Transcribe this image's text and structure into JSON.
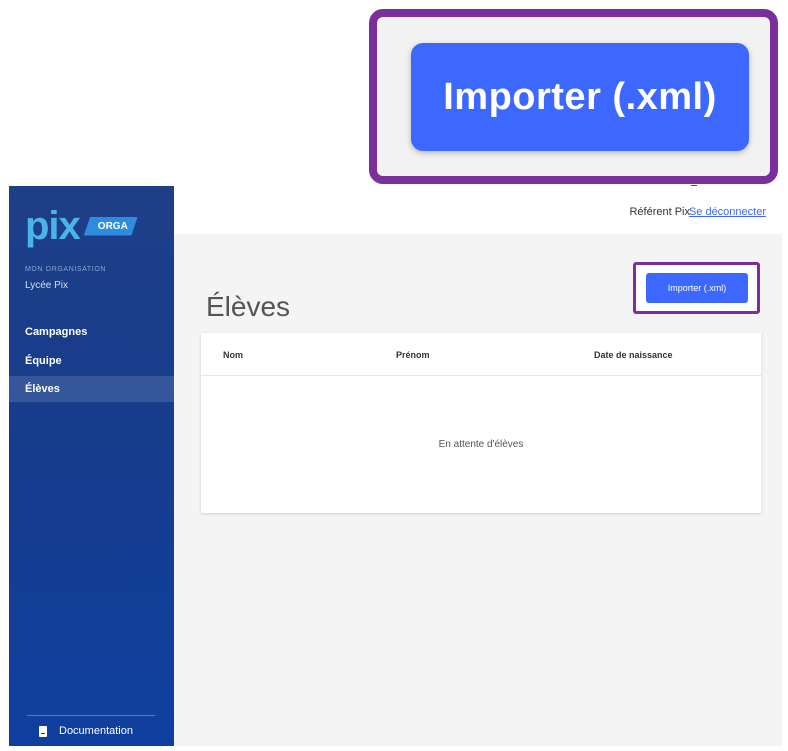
{
  "zoom": {
    "button_label": "Importer (.xml)"
  },
  "sidebar": {
    "logo_text": "pix",
    "logo_badge": "ORGA",
    "org_label": "MON ORGANISATION",
    "org_name": "Lycée Pix",
    "items": [
      {
        "label": "Campagnes"
      },
      {
        "label": "Équipe"
      },
      {
        "label": "Élèves",
        "active": true
      }
    ],
    "documentation_label": "Documentation"
  },
  "header": {
    "user_name": "Référent Pix",
    "logout_label": "Se déconnecter"
  },
  "main": {
    "title": "Élèves",
    "import_button": "Importer (.xml)",
    "table": {
      "columns": [
        "Nom",
        "Prénom",
        "Date de naissance"
      ],
      "empty_message": "En attente d'élèves"
    }
  },
  "colors": {
    "accent": "#3d68ff",
    "highlight": "#7a2f9a",
    "sidebar": "#163c8c"
  }
}
